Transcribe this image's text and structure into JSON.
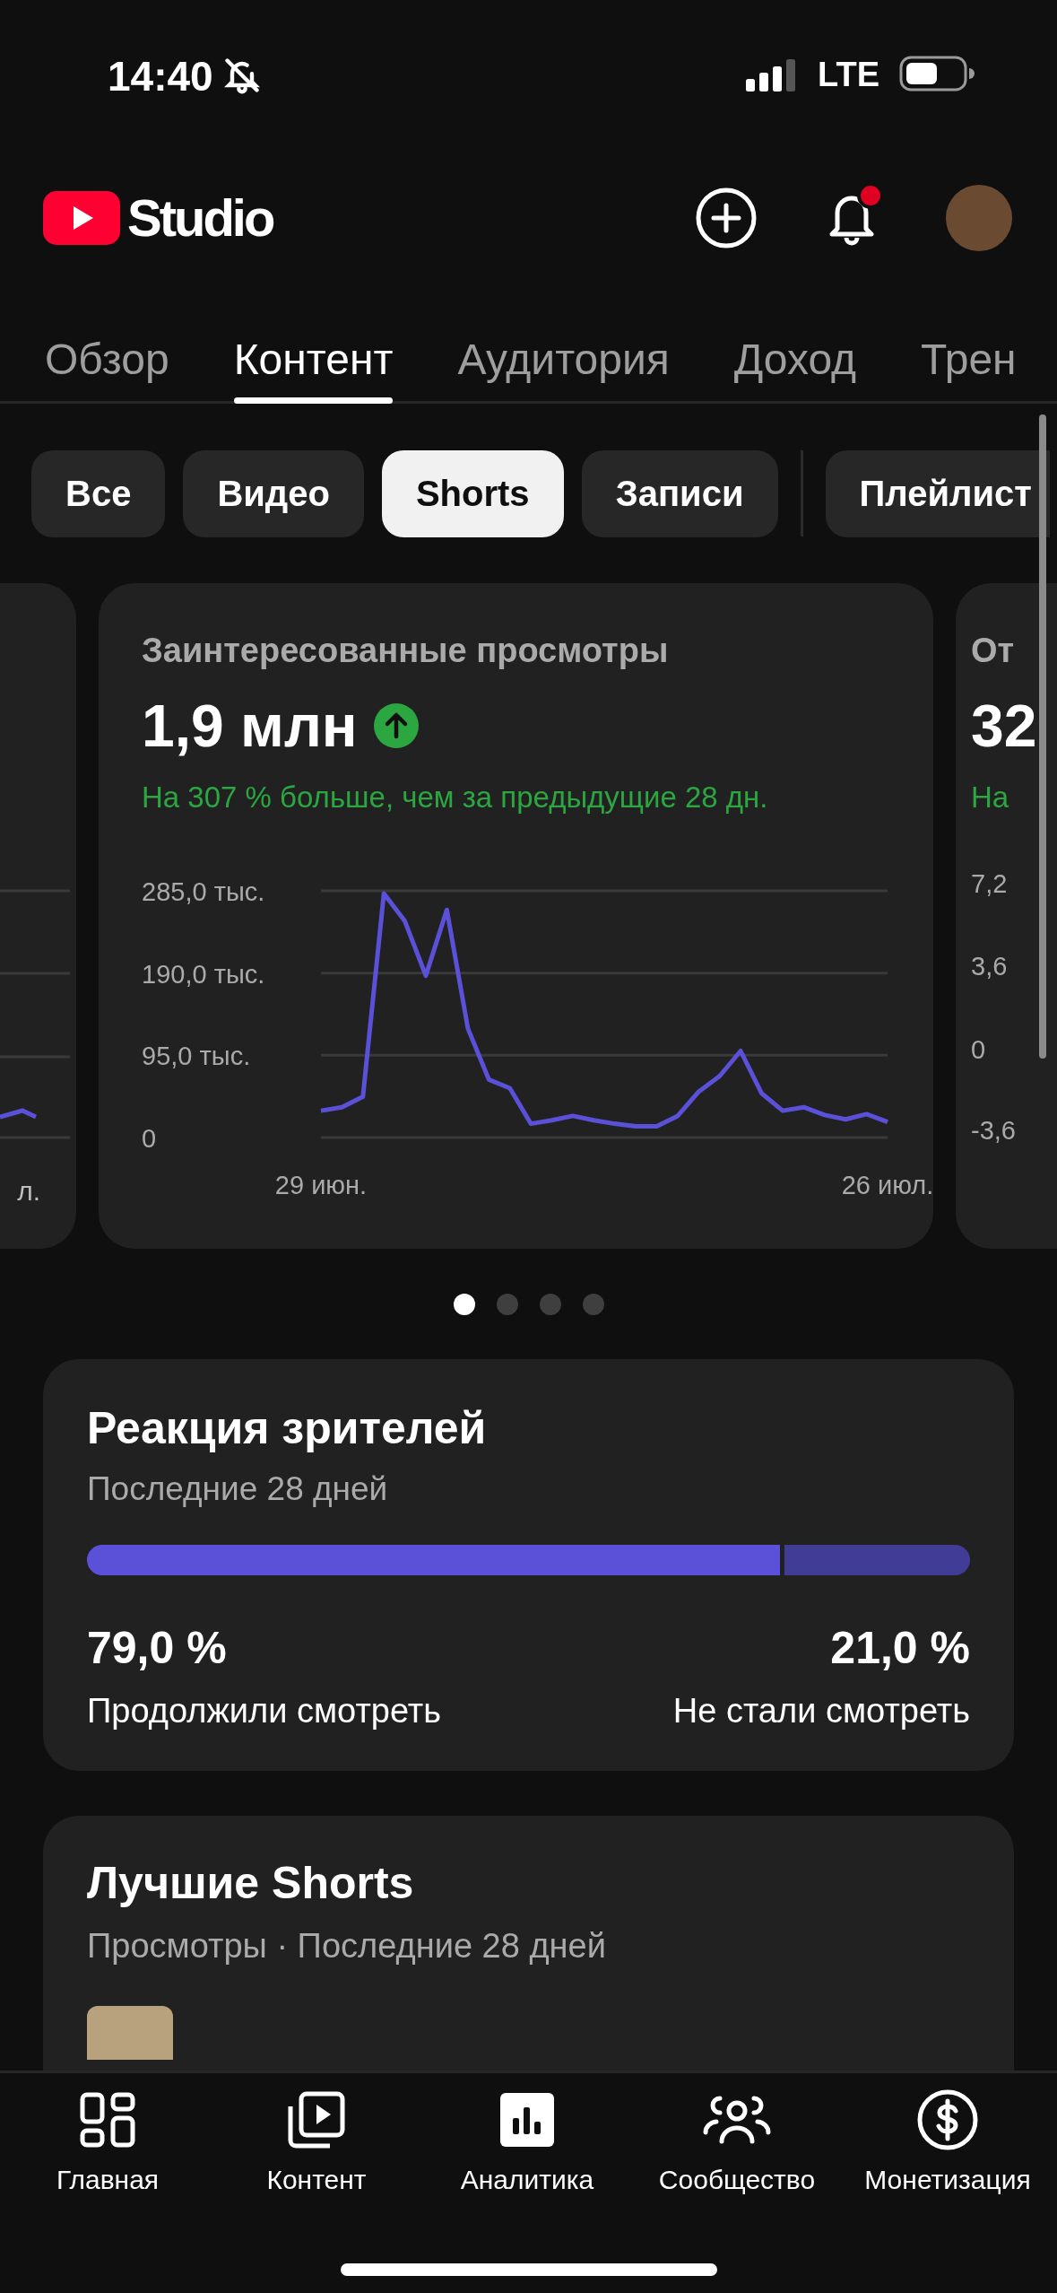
{
  "status_bar": {
    "time": "14:40",
    "network": "LTE"
  },
  "header": {
    "logo_text": "Studio",
    "has_notification": true
  },
  "tabs": [
    {
      "label": "Обзор",
      "selected": false
    },
    {
      "label": "Контент",
      "selected": true
    },
    {
      "label": "Аудитория",
      "selected": false
    },
    {
      "label": "Доход",
      "selected": false
    },
    {
      "label": "Трен",
      "selected": false
    }
  ],
  "filters": [
    {
      "label": "Все",
      "selected": false
    },
    {
      "label": "Видео",
      "selected": false
    },
    {
      "label": "Shorts",
      "selected": true
    },
    {
      "label": "Записи",
      "selected": false
    },
    {
      "label": "Плейлист",
      "selected": false
    }
  ],
  "carousel": {
    "previous_card": {
      "x_tick": "л."
    },
    "card": {
      "title": "Заинтересованные просмотры",
      "value": "1,9 млн",
      "rising": true,
      "change": "На 307 % больше, чем за предыдущие 28 дн.",
      "chart_data": {
        "type": "line",
        "categories": [
          "29 июн.",
          null,
          null,
          null,
          null,
          null,
          null,
          null,
          null,
          null,
          null,
          null,
          null,
          null,
          null,
          null,
          null,
          null,
          null,
          null,
          null,
          null,
          null,
          null,
          null,
          null,
          null,
          "26 июл."
        ],
        "series": [
          {
            "color": "#5b51d8",
            "values": [
              31,
              35,
              47,
              282,
              250,
              187,
              263,
              126,
              67,
              57,
              16,
              20,
              25,
              20,
              16,
              13,
              13,
              25,
              53,
              71,
              100,
              51,
              31,
              35,
              26,
              21,
              27,
              18
            ]
          }
        ],
        "ylim": [
          0,
          285
        ],
        "yticks": [
          {
            "value": 285,
            "label": "285,0 тыс."
          },
          {
            "value": 190,
            "label": "190,0 тыс."
          },
          {
            "value": 95,
            "label": "95,0 тыс."
          },
          {
            "value": 0,
            "label": "0"
          }
        ]
      }
    },
    "next_card": {
      "title": "От",
      "value": "32",
      "change": "На",
      "y_ticks": [
        "7,2",
        "3,6",
        "0",
        "-3,6"
      ]
    },
    "pages": [
      {
        "selected": true
      },
      {
        "selected": false
      },
      {
        "selected": false
      },
      {
        "selected": false
      }
    ]
  },
  "reaction": {
    "title": "Реакция зрителей",
    "subtitle": "Последние 28 дней",
    "level": 0.79,
    "left": {
      "value": "79,0 %",
      "label": "Продолжили смотреть"
    },
    "right": {
      "value": "21,0 %",
      "label": "Не стали смотреть"
    }
  },
  "best_shorts": {
    "title": "Лучшие Shorts",
    "subtitle": "Просмотры · Последние 28 дней"
  },
  "nav": [
    {
      "kind": "home",
      "label": "Главная",
      "selected": false
    },
    {
      "kind": "content",
      "label": "Контент",
      "selected": false
    },
    {
      "kind": "analytics",
      "label": "Аналитика",
      "selected": true
    },
    {
      "kind": "community",
      "label": "Сообщество",
      "selected": false
    },
    {
      "kind": "money",
      "label": "Монетизация",
      "selected": false
    }
  ]
}
